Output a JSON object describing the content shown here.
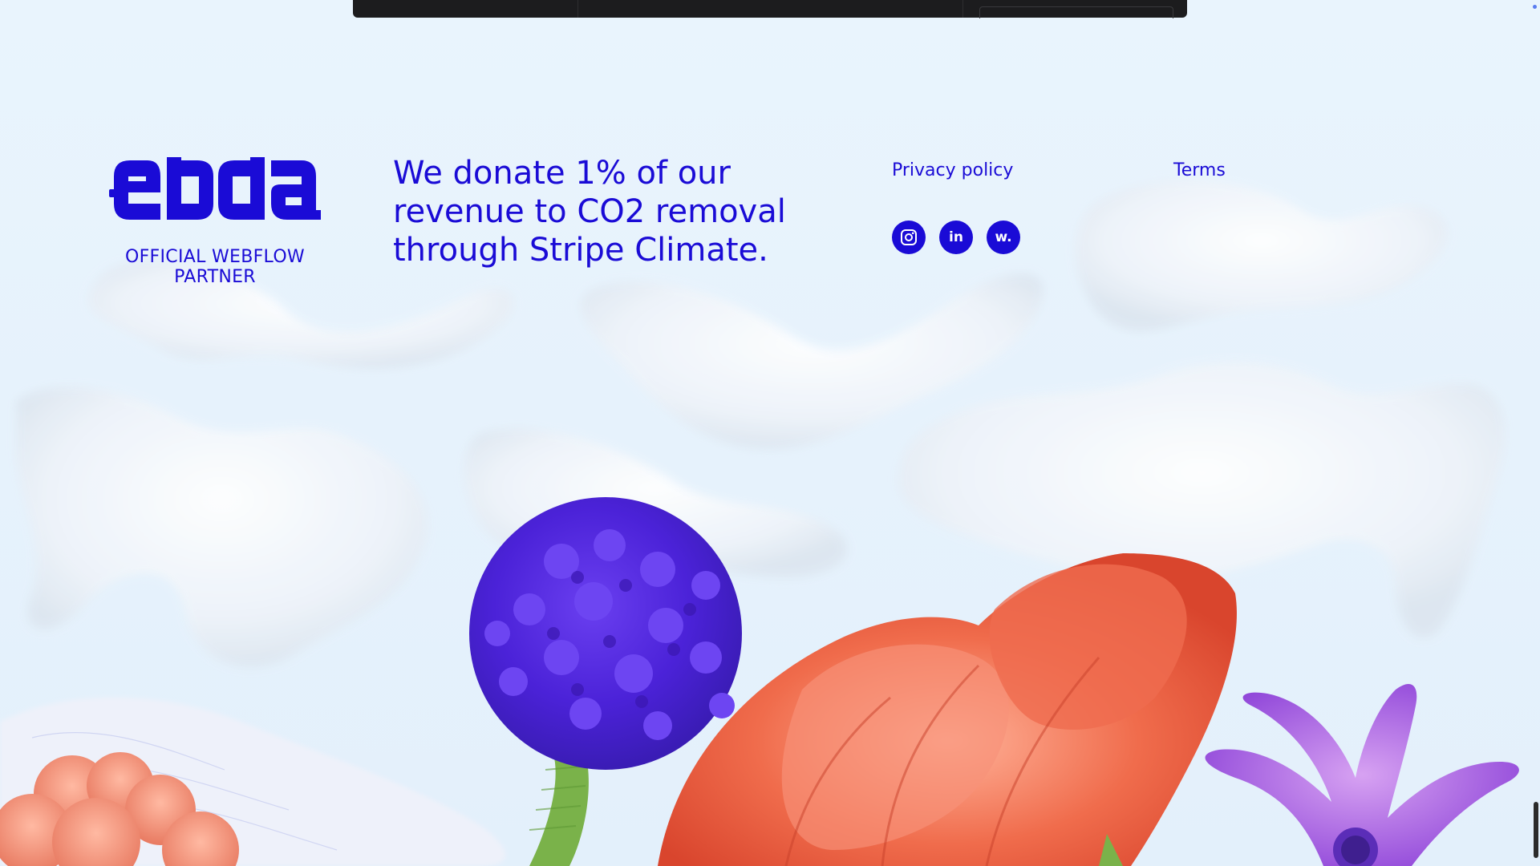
{
  "brand": {
    "name": "ebda",
    "partner_text": "OFFICIAL WEBFLOW PARTNER"
  },
  "footer": {
    "statement": "We donate 1% of our revenue to CO2 removal through Stripe Climate.",
    "links": {
      "privacy": "Privacy policy",
      "terms": "Terms"
    },
    "socials": [
      {
        "name": "instagram",
        "icon": "instagram-icon"
      },
      {
        "name": "linkedin",
        "icon": "linkedin-icon",
        "glyph": "in"
      },
      {
        "name": "webflow",
        "icon": "webflow-icon",
        "glyph": "w."
      }
    ]
  },
  "colors": {
    "brand_blue": "#1a0bd6",
    "background": "#e7f3fc"
  }
}
